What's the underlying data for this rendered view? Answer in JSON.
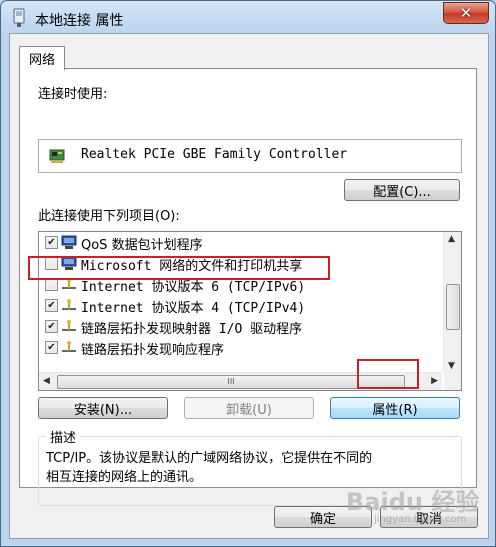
{
  "window": {
    "title": "本地连接 属性",
    "close_label": "✕"
  },
  "tabs": [
    {
      "label": "网络"
    }
  ],
  "connection": {
    "connect_using_label": "连接时使用:",
    "adapter_name": "Realtek PCIe GBE Family Controller",
    "configure_button": "配置(C)..."
  },
  "items": {
    "label": "此连接使用下列项目(O):",
    "list": [
      {
        "text": "QoS 数据包计划程序",
        "checked": true,
        "icon": "scheduler-icon"
      },
      {
        "text": "Microsoft 网络的文件和打印机共享",
        "checked": false,
        "icon": "file-printer-sharing-icon"
      },
      {
        "text": "Internet 协议版本 6 (TCP/IPv6)",
        "checked": false,
        "icon": "protocol-icon"
      },
      {
        "text": "Internet 协议版本 4 (TCP/IPv4)",
        "checked": true,
        "icon": "protocol-icon"
      },
      {
        "text": "链路层拓扑发现映射器 I/O 驱动程序",
        "checked": true,
        "icon": "protocol-icon"
      },
      {
        "text": "链路层拓扑发现响应程序",
        "checked": true,
        "icon": "protocol-icon"
      }
    ],
    "hscroll_grip": "III"
  },
  "buttons": {
    "install": "安装(N)...",
    "uninstall": "卸载(U)",
    "properties": "属性(R)"
  },
  "description": {
    "legend": "描述",
    "text": "TCP/IP。该协议是默认的广域网络协议，它提供在不同的\n相互连接的网络上的通讯。"
  },
  "footer": {
    "ok": "确定",
    "cancel": "取消"
  },
  "watermark": {
    "text": "Baidu 经验",
    "url": "jingyan.baidu.com"
  },
  "colors": {
    "annotation_red": "#c9202a",
    "title_bar": "#bcd4ee"
  }
}
